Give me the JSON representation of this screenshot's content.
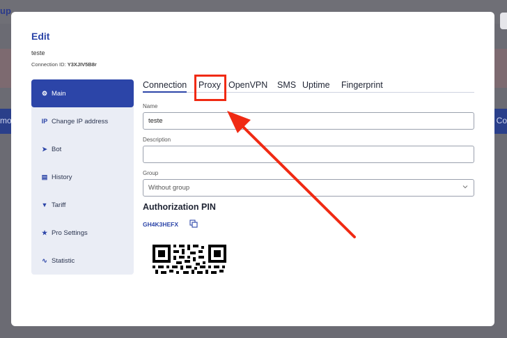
{
  "background": {
    "title_fragment": "up",
    "left_fragment": "mo",
    "right_fragment": "Co"
  },
  "modal": {
    "title": "Edit",
    "connection_name": "teste",
    "connection_id_label": "Connection ID:",
    "connection_id": "Y3XJIV5B8r"
  },
  "sidebar": {
    "items": [
      {
        "label": "Main",
        "icon": "gear-icon",
        "glyph": "⚙",
        "active": true
      },
      {
        "label": "Change IP address",
        "icon": "ip-icon",
        "glyph": "IP"
      },
      {
        "label": "Bot",
        "icon": "send-icon",
        "glyph": "➤"
      },
      {
        "label": "History",
        "icon": "document-icon",
        "glyph": "▤"
      },
      {
        "label": "Tariff",
        "icon": "basket-icon",
        "glyph": "▼"
      },
      {
        "label": "Pro Settings",
        "icon": "star-icon",
        "glyph": "★"
      },
      {
        "label": "Statistic",
        "icon": "pulse-icon",
        "glyph": "∿"
      }
    ]
  },
  "tabs": [
    "Connection",
    "Proxy",
    "OpenVPN",
    "SMS",
    "Uptime",
    "Fingerprint"
  ],
  "form": {
    "name_label": "Name",
    "name_value": "teste",
    "description_label": "Description",
    "description_value": "",
    "group_label": "Group",
    "group_value": "Without group"
  },
  "pin": {
    "title": "Authorization PIN",
    "code": "GH4K3HEFX"
  },
  "colors": {
    "accent": "#2c45a8",
    "annotation": "#f02a13"
  }
}
